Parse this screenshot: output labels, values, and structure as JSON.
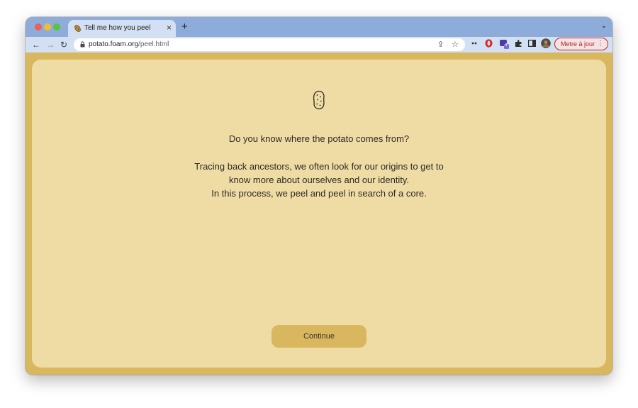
{
  "browser": {
    "tab": {
      "title": "Tell me how you peel",
      "favicon": "potato-icon",
      "close_glyph": "×"
    },
    "new_tab_glyph": "+",
    "tab_list_glyph": "⌄",
    "nav": {
      "back_glyph": "←",
      "forward_glyph": "→",
      "reload_glyph": "↻"
    },
    "address": {
      "domain": "potato.foam.org",
      "path": "/peel.html"
    },
    "omnibox_icons": {
      "share_glyph": "⇪",
      "bookmark_glyph": "☆"
    },
    "extension_icons": [
      "reading-mode-icon",
      "opera-icon",
      "extension-badge-icon",
      "puzzle-extensions-icon",
      "side-panel-icon",
      "profile-avatar"
    ],
    "extension_badge_count": "4",
    "update_button": {
      "label": "Metre à jour",
      "menu_glyph": "⋮"
    },
    "colors": {
      "tab_bar": "#8eacd9",
      "toolbar": "#d3e0f3",
      "page_frame": "#d9b75f",
      "panel": "#efdca5",
      "update_red": "#b3261e"
    }
  },
  "page": {
    "icon": "potato-icon",
    "question": "Do you know where the potato comes from?",
    "paragraph": [
      "Tracing back ancestors, we often look for our origins to get to",
      "know more about ourselves and our identity.",
      "In this process, we peel and peel in search of a core."
    ],
    "continue_label": "Continue"
  }
}
